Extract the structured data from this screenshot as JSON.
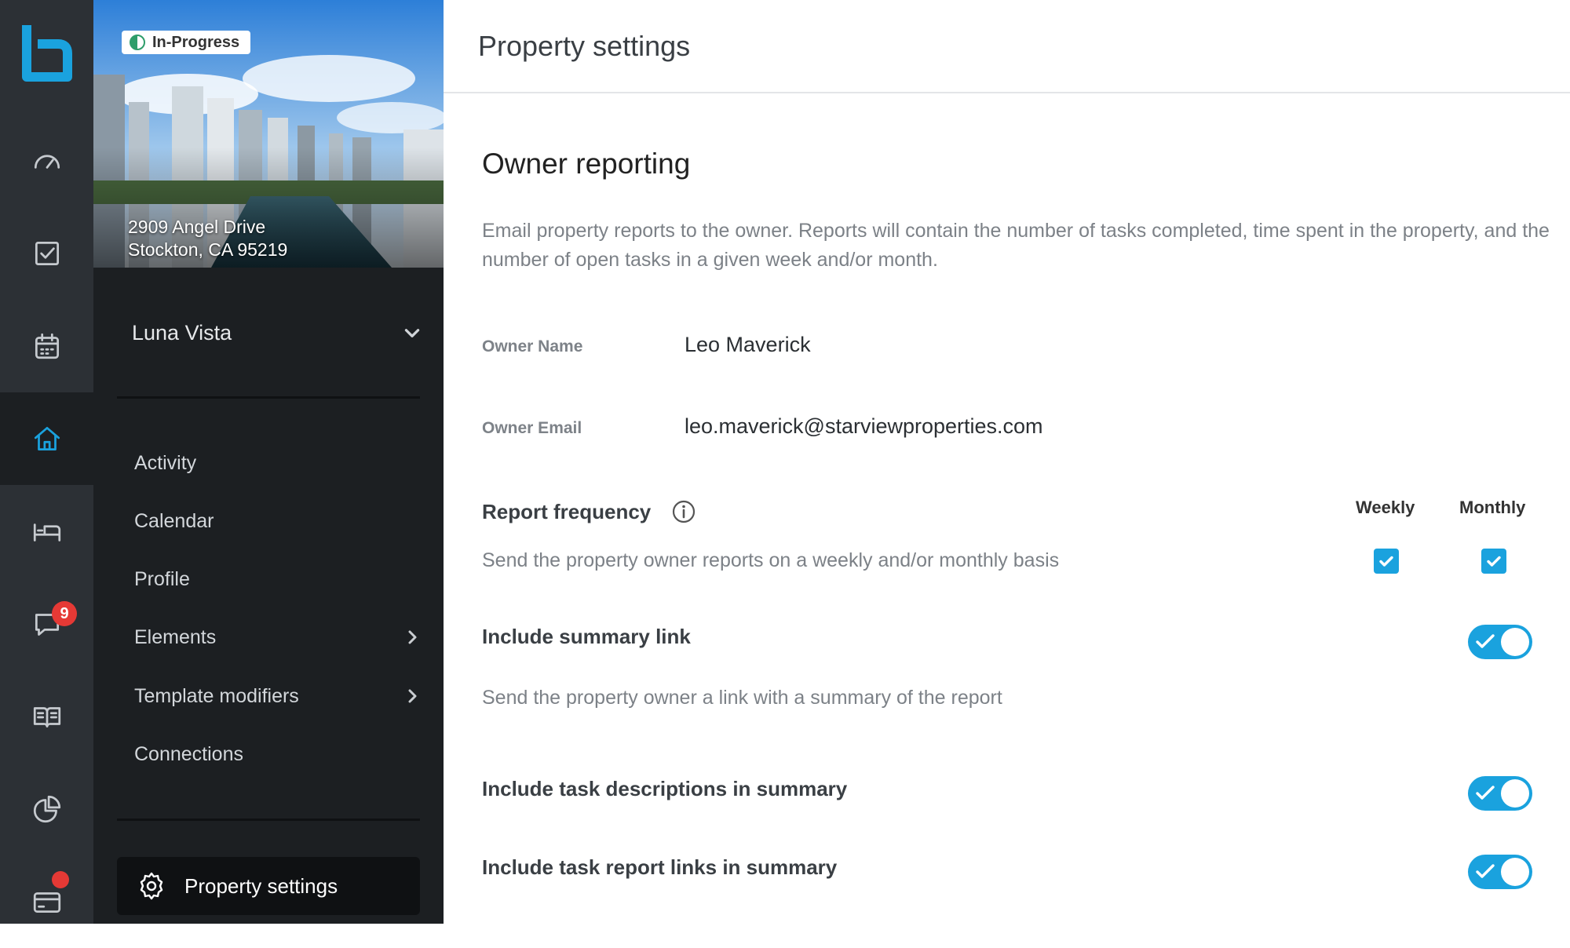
{
  "rail": {
    "logo": "b-logo-icon",
    "items": [
      {
        "name": "dashboard",
        "icon": "speedometer-icon"
      },
      {
        "name": "tasks",
        "icon": "checkbox-icon"
      },
      {
        "name": "calendar",
        "icon": "calendar-icon"
      },
      {
        "name": "properties",
        "icon": "home-icon",
        "active": true
      },
      {
        "name": "bookings",
        "icon": "bed-icon"
      },
      {
        "name": "messages",
        "icon": "chat-icon",
        "badge": "9"
      },
      {
        "name": "guides",
        "icon": "book-icon"
      },
      {
        "name": "reports",
        "icon": "pie-chart-icon"
      },
      {
        "name": "billing",
        "icon": "card-icon",
        "dot": true
      }
    ]
  },
  "sidebar": {
    "status": "In-Progress",
    "address_line1": "2909 Angel Drive",
    "address_line2": "Stockton, CA 95219",
    "property_name": "Luna Vista",
    "nav": [
      {
        "label": "Activity"
      },
      {
        "label": "Calendar"
      },
      {
        "label": "Profile"
      },
      {
        "label": "Elements",
        "has_submenu": true
      },
      {
        "label": "Template modifiers",
        "has_submenu": true
      },
      {
        "label": "Connections"
      }
    ],
    "settings_label": "Property settings"
  },
  "main": {
    "page_title": "Property settings",
    "section_title": "Owner reporting",
    "section_desc": "Email property reports to the owner. Reports will contain the number of tasks completed, time spent in the property, and the number of open tasks in a given week and/or month.",
    "owner_name_label": "Owner Name",
    "owner_name": "Leo Maverick",
    "owner_email_label": "Owner Email",
    "owner_email": "leo.maverick@starviewproperties.com",
    "frequency": {
      "title": "Report frequency",
      "desc": "Send the property owner reports on a weekly and/or monthly basis",
      "weekly_label": "Weekly",
      "monthly_label": "Monthly",
      "weekly_checked": true,
      "monthly_checked": true
    },
    "summary_link": {
      "title": "Include summary link",
      "desc": "Send the property owner a link with a summary of the report",
      "enabled": true
    },
    "task_descriptions": {
      "title": "Include task descriptions in summary",
      "enabled": true
    },
    "task_report_links": {
      "title": "Include task report links in summary",
      "enabled": true
    }
  },
  "colors": {
    "accent": "#1aa2de",
    "rail_bg": "#2c3035",
    "sidebar_bg": "#1c1f22",
    "badge": "#e53935"
  }
}
